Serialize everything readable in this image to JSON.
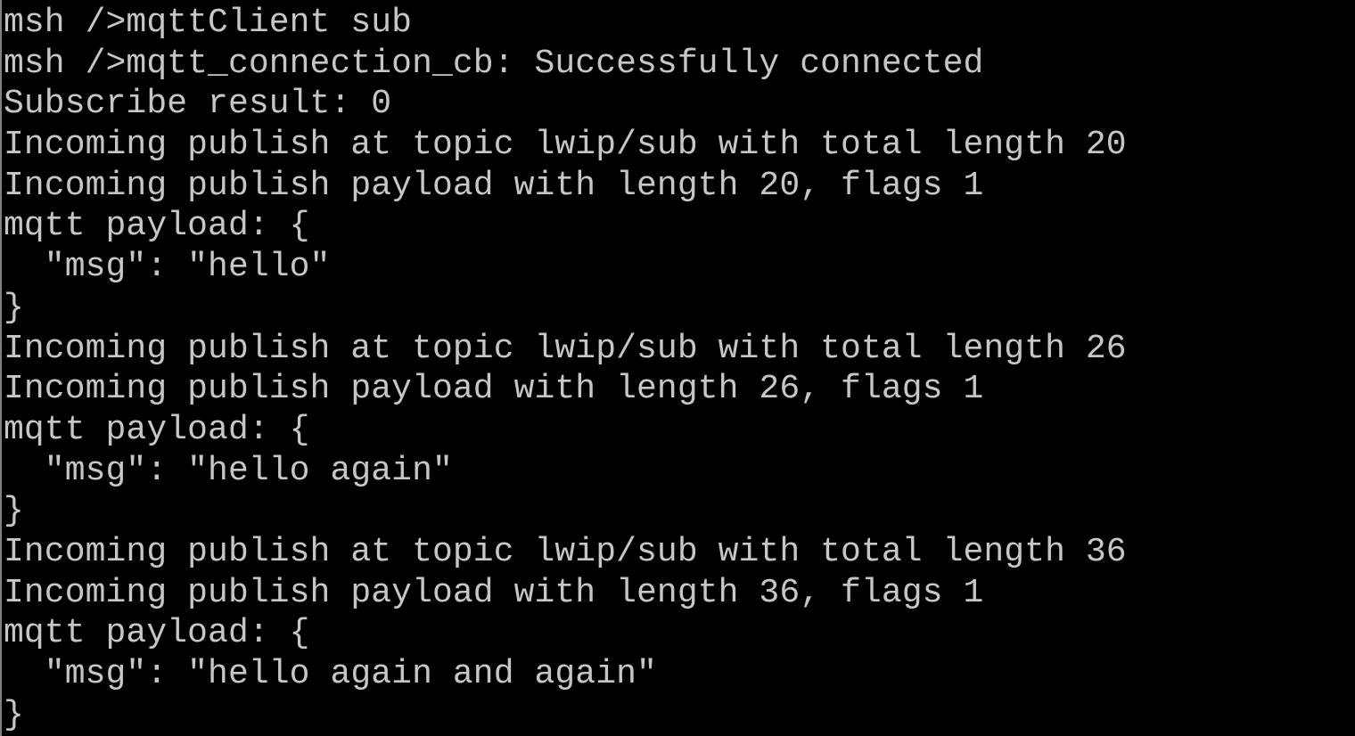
{
  "terminal": {
    "lines": [
      "msh />mqttClient sub",
      "msh />mqtt_connection_cb: Successfully connected",
      "Subscribe result: 0",
      "Incoming publish at topic lwip/sub with total length 20",
      "Incoming publish payload with length 20, flags 1",
      "mqtt payload: {",
      "  \"msg\": \"hello\"",
      "}",
      "Incoming publish at topic lwip/sub with total length 26",
      "Incoming publish payload with length 26, flags 1",
      "mqtt payload: {",
      "  \"msg\": \"hello again\"",
      "}",
      "Incoming publish at topic lwip/sub with total length 36",
      "Incoming publish payload with length 36, flags 1",
      "mqtt payload: {",
      "  \"msg\": \"hello again and again\"",
      "}"
    ],
    "colors": {
      "background": "#000000",
      "text": "#c6c6c6"
    }
  }
}
